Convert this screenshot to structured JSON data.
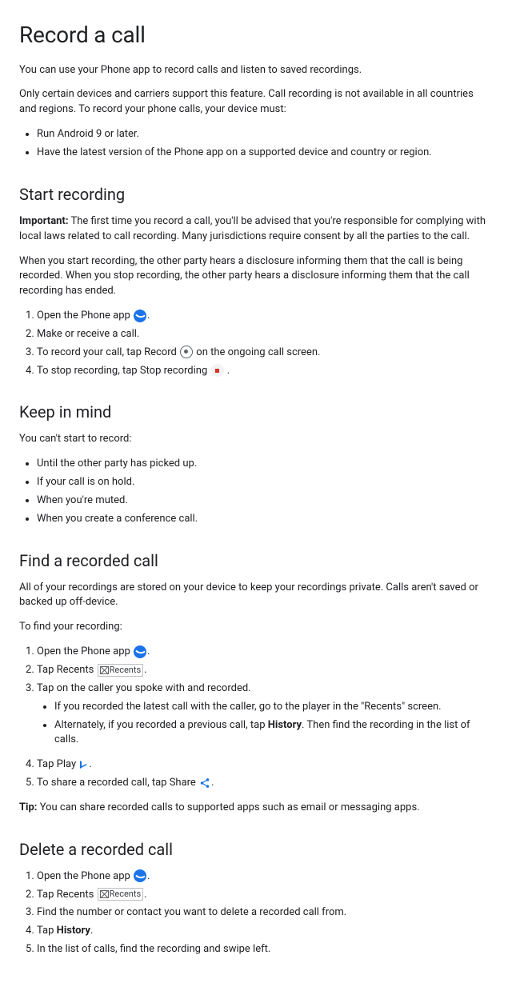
{
  "title": "Record a call",
  "intro1": "You can use your Phone app to record calls and listen to saved recordings.",
  "intro2": "Only certain devices and carriers support this feature. Call recording is not available in all countries and regions. To record your phone calls, your device must:",
  "requirements": [
    "Run Android 9 or later.",
    "Have the latest version of the Phone app on a supported device and country or region."
  ],
  "start": {
    "heading": "Start recording",
    "important_label": "Important:",
    "important_text": " The first time you record a call, you'll be advised that you're responsible for complying with local laws related to call recording. Many jurisdictions require consent by all the parties to the call.",
    "disclosure": "When you start recording, the other party hears a disclosure informing them that the call is being recorded. When you stop recording, the other party hears a disclosure informing them that the call recording has ended.",
    "steps": {
      "s1a": "Open the Phone app ",
      "s1b": ".",
      "s2": "Make or receive a call.",
      "s3a": "To record your call, tap Record ",
      "s3b": " on the ongoing call screen.",
      "s4a": "To stop recording, tap Stop recording ",
      "s4b": " ."
    }
  },
  "keep": {
    "heading": "Keep in mind",
    "intro": "You can't start to record:",
    "items": [
      "Until the other party has picked up.",
      "If your call is on hold.",
      "When you're muted.",
      "When you create a conference call."
    ]
  },
  "find": {
    "heading": "Find a recorded call",
    "intro": "All of your recordings are stored on your device to keep your recordings private. Calls aren't saved or backed up off-device.",
    "intro2": "To find your recording:",
    "steps": {
      "s1a": "Open the Phone app ",
      "s1b": ".",
      "s2a": "Tap Recents ",
      "s2alt": "Recents",
      "s2b": ".",
      "s3": "Tap on the caller you spoke with and recorded.",
      "s3sub1": "If you recorded the latest call with the caller, go to the player in the \"Recents\" screen.",
      "s3sub2a": "Alternately, if you recorded a previous call, tap ",
      "s3sub2bold": "History",
      "s3sub2b": ". Then find the recording in the list of calls.",
      "s4a": "Tap Play ",
      "s4b": ".",
      "s5a": "To share a recorded call, tap Share ",
      "s5b": "."
    },
    "tip_label": "Tip:",
    "tip_text": " You can share recorded calls to supported apps such as email or messaging apps."
  },
  "delete": {
    "heading": "Delete a recorded call",
    "steps": {
      "s1a": "Open the Phone app ",
      "s1b": ".",
      "s2a": "Tap Recents ",
      "s2alt": "Recents",
      "s2b": ".",
      "s3": "Find the number or contact you want to delete a recorded call from.",
      "s4a": "Tap ",
      "s4bold": "History",
      "s4b": ".",
      "s5": "In the list of calls, find the recording and swipe left."
    }
  }
}
